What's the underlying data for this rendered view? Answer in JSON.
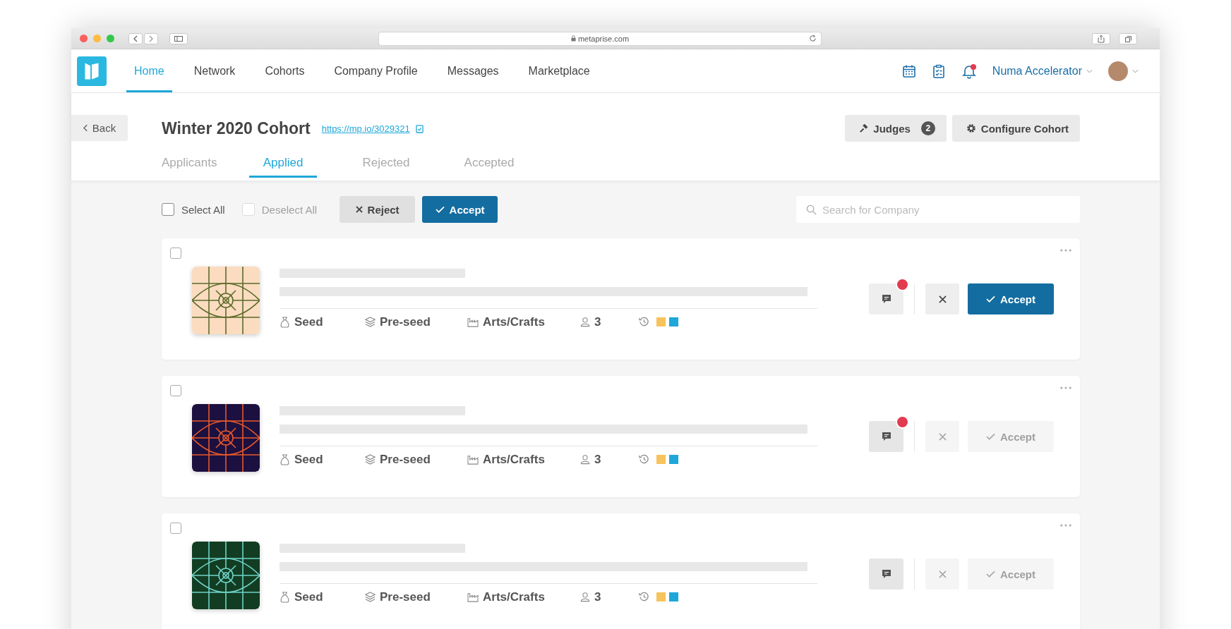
{
  "browser": {
    "url": "metaprise.com"
  },
  "nav": {
    "items": [
      {
        "label": "Home",
        "selected": true
      },
      {
        "label": "Network",
        "selected": false
      },
      {
        "label": "Cohorts",
        "selected": false
      },
      {
        "label": "Company Profile",
        "selected": false
      },
      {
        "label": "Messages",
        "selected": false
      },
      {
        "label": "Marketplace",
        "selected": false
      }
    ],
    "unread_notifications": true,
    "account": "Numa Accelerator"
  },
  "header": {
    "back": "Back",
    "title": "Winter 2020 Cohort",
    "link": "https://mp.io/3029321",
    "judges": {
      "label": "Judges",
      "count": "2"
    },
    "configure": "Configure Cohort",
    "tabs": [
      {
        "label": "Applicants",
        "selected": false
      },
      {
        "label": "Applied",
        "selected": true
      },
      {
        "label": "Rejected",
        "selected": false
      },
      {
        "label": "Accepted",
        "selected": false
      }
    ]
  },
  "toolbar": {
    "select_all": {
      "label": "Select All",
      "checked": false,
      "disabled": false
    },
    "deselect_all": {
      "label": "Deselect All",
      "checked": false,
      "disabled": true
    },
    "reject": "Reject",
    "accept": "Accept",
    "search": {
      "placeholder": "Search for Company"
    }
  },
  "cards": [
    {
      "checked": false,
      "kind": "peach",
      "unread": true,
      "actions_enabled": true,
      "accept": "Accept",
      "tags": [
        {
          "kind": "funding",
          "label": "Seed"
        },
        {
          "kind": "stage",
          "label": "Pre-seed"
        },
        {
          "kind": "industry",
          "label": "Arts/Crafts"
        },
        {
          "kind": "team",
          "label": "3"
        }
      ],
      "history": [
        {
          "color": "#f7c35c"
        },
        {
          "color": "#1ea7d9"
        }
      ]
    },
    {
      "checked": false,
      "kind": "navy",
      "unread": true,
      "actions_enabled": false,
      "accept": "Accept",
      "tags": [
        {
          "kind": "funding",
          "label": "Seed"
        },
        {
          "kind": "stage",
          "label": "Pre-seed"
        },
        {
          "kind": "industry",
          "label": "Arts/Crafts"
        },
        {
          "kind": "team",
          "label": "3"
        }
      ],
      "history": [
        {
          "color": "#f7c35c"
        },
        {
          "color": "#1ea7d9"
        }
      ]
    },
    {
      "checked": false,
      "kind": "green",
      "unread": false,
      "actions_enabled": false,
      "accept": "Accept",
      "tags": [
        {
          "kind": "funding",
          "label": "Seed"
        },
        {
          "kind": "stage",
          "label": "Pre-seed"
        },
        {
          "kind": "industry",
          "label": "Arts/Crafts"
        },
        {
          "kind": "team",
          "label": "3"
        }
      ],
      "history": [
        {
          "color": "#f7c35c"
        },
        {
          "color": "#1ea7d9"
        }
      ]
    }
  ]
}
